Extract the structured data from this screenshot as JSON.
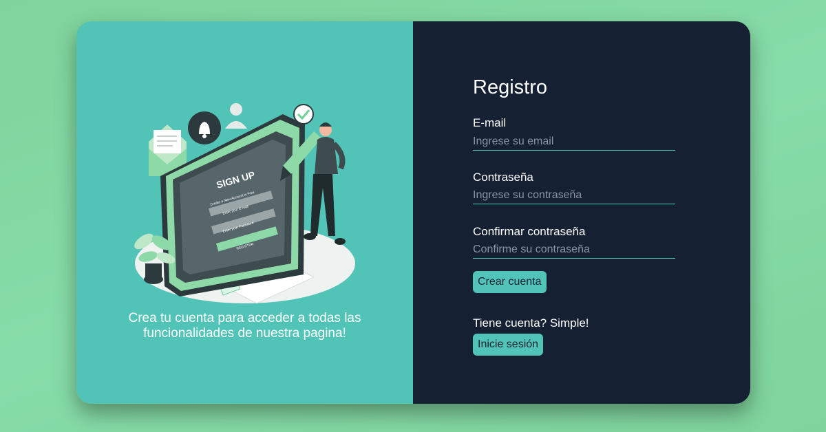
{
  "colors": {
    "background": "#86dca8",
    "left_panel": "#52c4b7",
    "right_panel": "#152033",
    "accent": "#52c4b7"
  },
  "illustration": {
    "heading": "SIGN UP",
    "subheading": "Create a New Account is Free",
    "email_field": "Enter your E-mail",
    "password_field": "Enter your Password",
    "button": "REGISTER"
  },
  "tagline": "Crea tu cuenta para acceder a todas las funcionalidades de nuestra pagina!",
  "form": {
    "title": "Registro",
    "email": {
      "label": "E-mail",
      "placeholder": "Ingrese su email"
    },
    "password": {
      "label": "Contraseña",
      "placeholder": "Ingrese su contraseña"
    },
    "confirm": {
      "label": "Confirmar contraseña",
      "placeholder": "Confirme su contraseña"
    },
    "submit_label": "Crear cuenta"
  },
  "login": {
    "prompt": "Tiene cuenta? Simple!",
    "button_label": "Inicie sesión"
  }
}
